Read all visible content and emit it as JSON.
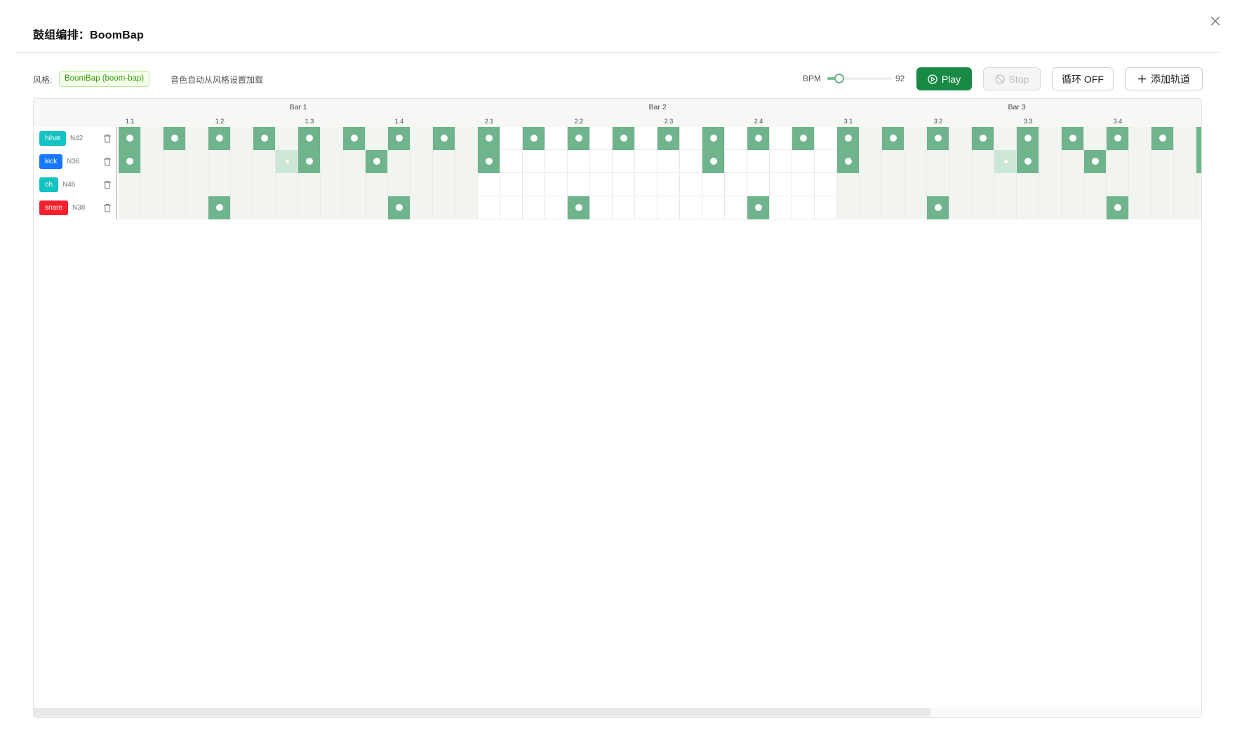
{
  "dialog": {
    "title": "鼓组编排：BoomBap"
  },
  "toolbar": {
    "style_label": "风格:",
    "style_value": "BoomBap (boom-bap)",
    "style_hint": "音色自动从风格设置加载",
    "bpm_label": "BPM",
    "bpm_value": "92",
    "bpm_fraction": 0.18,
    "play_label": "Play",
    "stop_label": "Stop",
    "loop_label": "循环 OFF",
    "add_track_label": "添加轨道"
  },
  "grid": {
    "bars": [
      "Bar 1",
      "Bar 2",
      "Bar 3"
    ],
    "beats": [
      "1.1",
      "1.2",
      "1.3",
      "1.4",
      "2.1",
      "2.2",
      "2.3",
      "2.4",
      "3.1",
      "3.2",
      "3.3",
      "3.4"
    ],
    "visible_steps": 49,
    "tracks": [
      {
        "name": "hihat",
        "note": "N42",
        "color": "#13c2c2",
        "hits": [
          0,
          2,
          4,
          6,
          8,
          10,
          12,
          14,
          16,
          18,
          20,
          22,
          24,
          26,
          28,
          30,
          32,
          34,
          36,
          38,
          40,
          42,
          44,
          46,
          48
        ],
        "ghost": []
      },
      {
        "name": "kick",
        "note": "N36",
        "color": "#1677ff",
        "hits": [
          0,
          8,
          11,
          16,
          26,
          32,
          40,
          43,
          48
        ],
        "ghost": [
          7,
          39
        ]
      },
      {
        "name": "oh",
        "note": "N46",
        "color": "#13c2c2",
        "hits": [],
        "ghost": []
      },
      {
        "name": "snare",
        "note": "N38",
        "color": "#f5222d",
        "hits": [
          4,
          12,
          20,
          28,
          36,
          44
        ],
        "ghost": []
      }
    ]
  },
  "colors": {
    "active_cell": "#6fb48c",
    "ghost_cell": "#cde7d6",
    "play_button": "#198a45"
  },
  "icons": [
    "close-icon",
    "play-circle-icon",
    "stop-icon",
    "plus-icon",
    "trash-icon"
  ]
}
